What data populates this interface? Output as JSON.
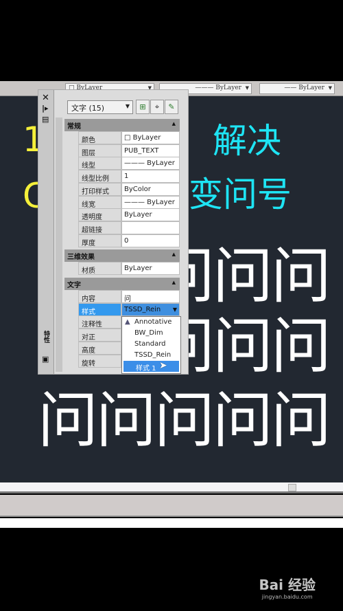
{
  "toolbar": {
    "layer_value": "ByLayer",
    "linetype_value": "ByLayer",
    "lineweight_value": "ByLayer"
  },
  "canvas": {
    "line1_prefix": "1",
    "line1_text": "解决",
    "line2_prefix": "C",
    "line2_text": "变问号",
    "grid_char": "问",
    "colors": {
      "background": "#222831",
      "yellow": "#f5f03a",
      "cyan": "#1ee4f4",
      "white": "#ffffff"
    }
  },
  "panel": {
    "strip_icons": [
      "close-icon",
      "pin-icon",
      "properties-icon"
    ],
    "strip_label": "特性",
    "object_select": "文字 (15)",
    "sections": [
      {
        "title": "常规",
        "rows": [
          {
            "label": "颜色",
            "value": "ByLayer",
            "swatch": true
          },
          {
            "label": "图层",
            "value": "PUB_TEXT"
          },
          {
            "label": "线型",
            "value": "——— ByLayer"
          },
          {
            "label": "线型比例",
            "value": "1"
          },
          {
            "label": "打印样式",
            "value": "ByColor"
          },
          {
            "label": "线宽",
            "value": "——— ByLayer"
          },
          {
            "label": "透明度",
            "value": "ByLayer"
          },
          {
            "label": "超链接",
            "value": ""
          },
          {
            "label": "厚度",
            "value": "0"
          }
        ]
      },
      {
        "title": "三维效果",
        "rows": [
          {
            "label": "材质",
            "value": "ByLayer"
          }
        ]
      },
      {
        "title": "文字",
        "rows": [
          {
            "label": "内容",
            "value": "问"
          },
          {
            "label": "样式",
            "value": "TSSD_Rein",
            "selected": true
          },
          {
            "label": "注释性",
            "value": ""
          },
          {
            "label": "对正",
            "value": ""
          },
          {
            "label": "高度",
            "value": ""
          },
          {
            "label": "旋转",
            "value": ""
          }
        ]
      }
    ],
    "style_dropdown": {
      "options": [
        "Annotative",
        "BW_Dim",
        "Standard",
        "TSSD_Rein",
        "样式 1"
      ],
      "highlighted": "样式 1"
    }
  },
  "watermark": {
    "brand": "Bai 经验",
    "url": "jingyan.baidu.com"
  }
}
